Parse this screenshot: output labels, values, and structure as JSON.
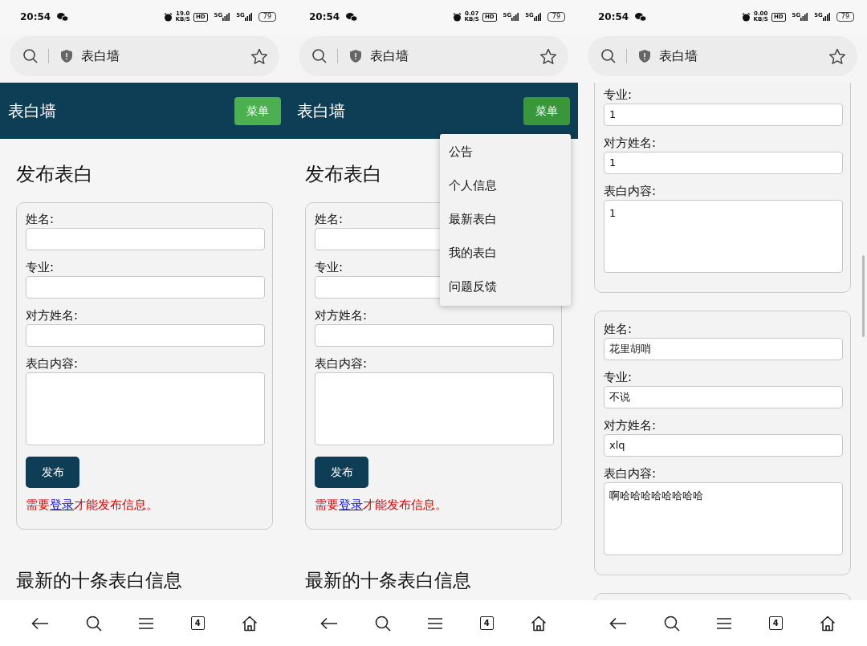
{
  "phones": [
    {
      "status_bar": {
        "time": "20:54",
        "speed": "19.0",
        "speed_unit": "KB/S",
        "hd": "HD",
        "networks": [
          "5G",
          "5G"
        ],
        "battery": "79"
      },
      "address_bar": {
        "title": "表白墙"
      },
      "screen": {
        "kind": "form",
        "navbar": {
          "title": "表白墙",
          "menu_button": {
            "label": "菜单",
            "pressed": false
          }
        },
        "heading": "发布表白",
        "fields": [
          {
            "label": "姓名:",
            "kind": "text"
          },
          {
            "label": "专业:",
            "kind": "text"
          },
          {
            "label": "对方姓名:",
            "kind": "text"
          },
          {
            "label": "表白内容:",
            "kind": "textarea"
          }
        ],
        "submit": "发布",
        "notice": {
          "before": "需要",
          "link": "登录",
          "after": "才能发布信息。"
        },
        "list_heading": "最新的十条表白信息"
      },
      "nav": {
        "tabs": "4"
      }
    },
    {
      "status_bar": {
        "time": "20:54",
        "speed": "0.07",
        "speed_unit": "KB/S",
        "hd": "HD",
        "networks": [
          "5G",
          "5G"
        ],
        "battery": "79"
      },
      "address_bar": {
        "title": "表白墙"
      },
      "screen": {
        "kind": "form",
        "navbar": {
          "title": "表白墙",
          "menu_button": {
            "label": "菜单",
            "pressed": true
          }
        },
        "menu": {
          "open": true,
          "items": [
            "公告",
            "个人信息",
            "最新表白",
            "我的表白",
            "问题反馈"
          ]
        },
        "heading": "发布表白",
        "fields": [
          {
            "label": "姓名:",
            "kind": "text"
          },
          {
            "label": "专业:",
            "kind": "text"
          },
          {
            "label": "对方姓名:",
            "kind": "text"
          },
          {
            "label": "表白内容:",
            "kind": "textarea"
          }
        ],
        "submit": "发布",
        "notice": {
          "before": "需要",
          "link": "登录",
          "after": "才能发布信息。"
        },
        "list_heading": "最新的十条表白信息"
      },
      "nav": {
        "tabs": "4"
      }
    },
    {
      "status_bar": {
        "time": "20:54",
        "speed": "0.00",
        "speed_unit": "KB/S",
        "hd": "HD",
        "networks": [
          "5G",
          "5G"
        ],
        "battery": "79"
      },
      "address_bar": {
        "title": "表白墙"
      },
      "screen": {
        "kind": "list",
        "cards": [
          {
            "kind": "clipped_top",
            "fields": [
              {
                "label": "专业:",
                "kind": "text",
                "value": "1"
              },
              {
                "label": "对方姓名:",
                "kind": "text",
                "value": "1"
              },
              {
                "label": "表白内容:",
                "kind": "textarea",
                "value": "1"
              }
            ]
          },
          {
            "kind": "full",
            "fields": [
              {
                "label": "姓名:",
                "kind": "text",
                "value": "花里胡哨"
              },
              {
                "label": "专业:",
                "kind": "text",
                "value": "不说"
              },
              {
                "label": "对方姓名:",
                "kind": "text",
                "value": "xlq"
              },
              {
                "label": "表白内容:",
                "kind": "textarea",
                "value": "啊哈哈哈哈哈哈哈哈"
              }
            ]
          },
          {
            "kind": "clipped_bottom"
          }
        ]
      },
      "nav": {
        "tabs": "4"
      }
    }
  ]
}
